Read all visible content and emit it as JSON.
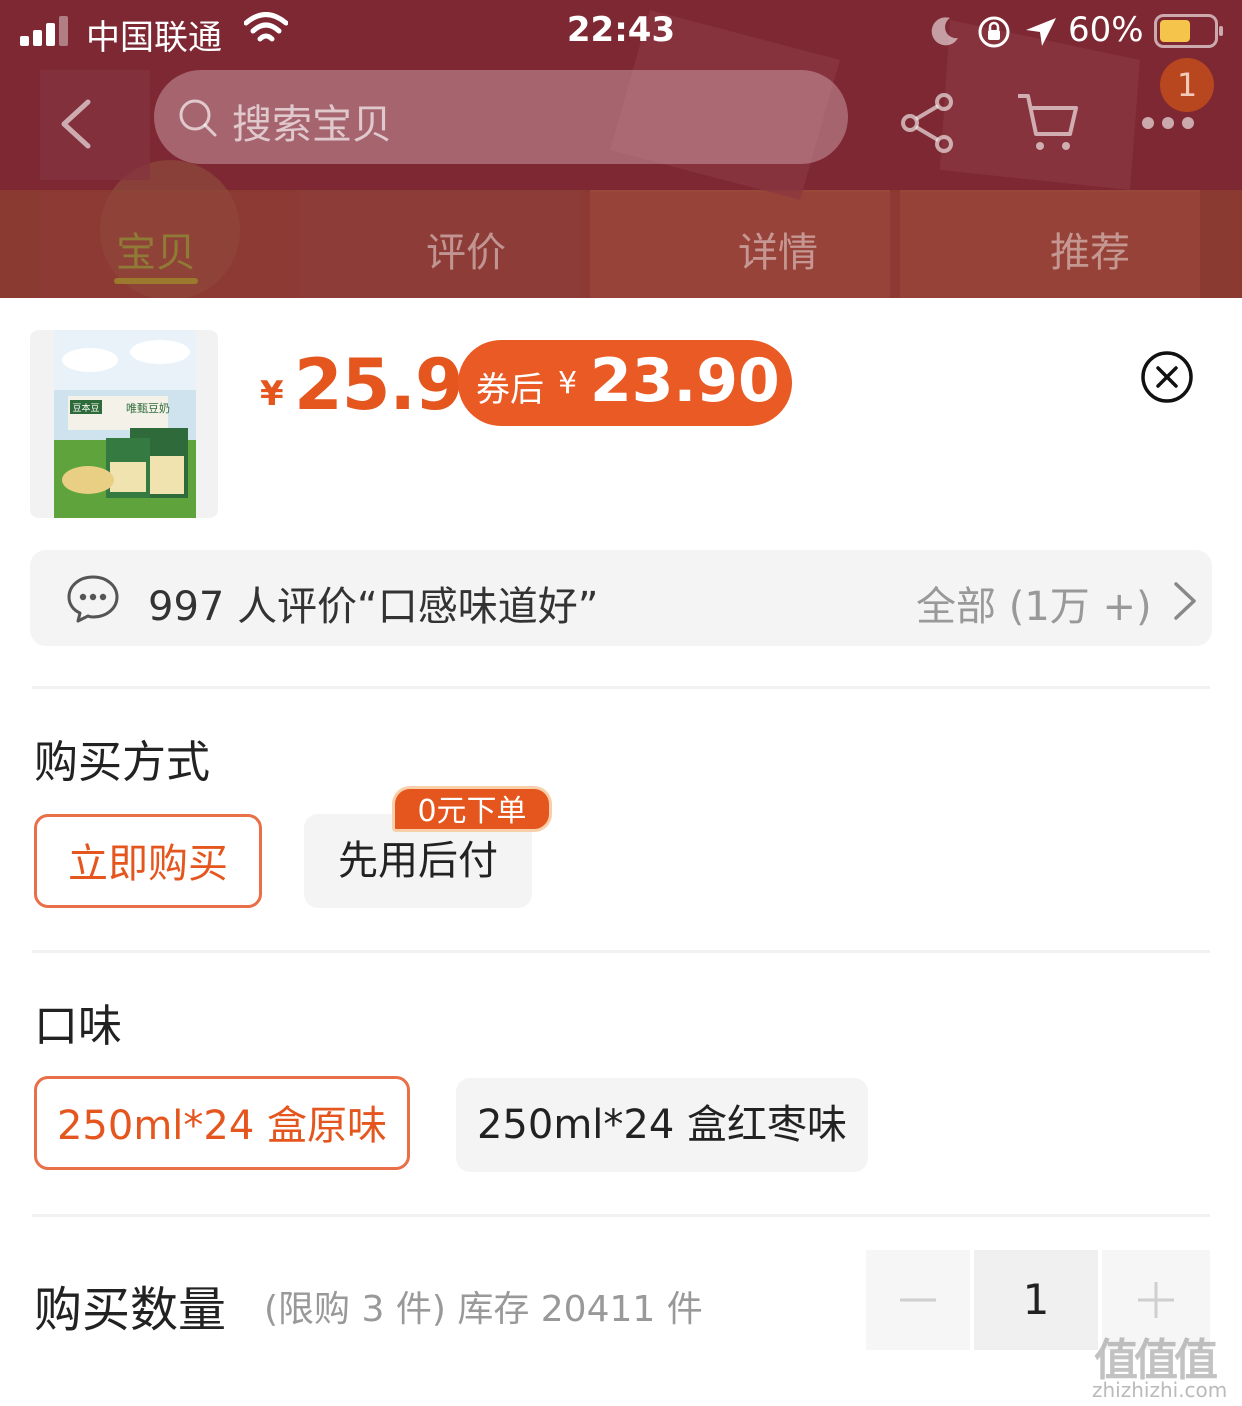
{
  "status_bar": {
    "carrier": "中国联通",
    "time": "22:43",
    "battery": "60%"
  },
  "nav": {
    "search_placeholder": "搜索宝贝",
    "cart_count": "1"
  },
  "tabs": [
    {
      "label": "宝贝",
      "active": true
    },
    {
      "label": "评价",
      "active": false
    },
    {
      "label": "详情",
      "active": false
    },
    {
      "label": "推荐",
      "active": false
    }
  ],
  "product": {
    "price_symbol": "¥",
    "price": "25.9",
    "coupon_label": "券后",
    "coupon_symbol": "¥",
    "coupon_price": "23.90",
    "thumb_brand": "豆本豆",
    "thumb_name": "唯甄豆奶"
  },
  "review": {
    "summary": "997 人评价“口感味道好”",
    "all_label": "全部 (1万 +)"
  },
  "purchase_method": {
    "title": "购买方式",
    "options": [
      {
        "label": "立即购买",
        "selected": true
      },
      {
        "label": "先用后付",
        "selected": false,
        "badge": "0元下单"
      }
    ]
  },
  "flavor": {
    "title": "口味",
    "options": [
      {
        "label": "250ml*24 盒原味",
        "selected": true
      },
      {
        "label": "250ml*24 盒红枣味",
        "selected": false
      }
    ]
  },
  "quantity": {
    "title": "购买数量",
    "note": "(限购 3 件) 库存 20411 件",
    "value": "1"
  },
  "watermark": {
    "logo": "值值值",
    "url": "zhizhizhi.com"
  },
  "colors": {
    "accent": "#e5561f",
    "coupon_bg": "#ea5a25",
    "header_bg": "#7a2631"
  }
}
